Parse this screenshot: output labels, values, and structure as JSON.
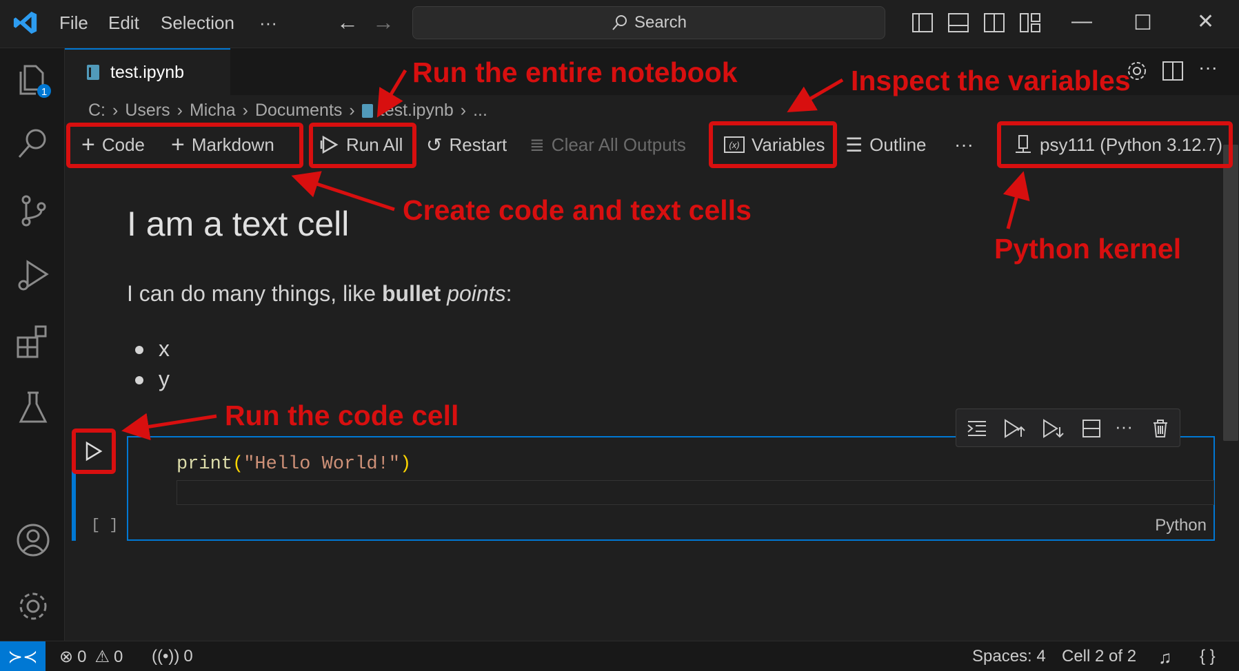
{
  "titlebar": {
    "menu": [
      "File",
      "Edit",
      "Selection",
      "···"
    ],
    "search_label": "Search"
  },
  "activity_bar": {
    "explorer_badge": "1"
  },
  "tab": {
    "label": "test.ipynb"
  },
  "breadcrumb": [
    "C:",
    "Users",
    "Micha",
    "Documents",
    "test.ipynb",
    "..."
  ],
  "notebook_toolbar": {
    "code": "Code",
    "markdown": "Markdown",
    "run_all": "Run All",
    "restart": "Restart",
    "clear_all_outputs": "Clear All Outputs",
    "variables": "Variables",
    "outline": "Outline",
    "more": "···",
    "kernel": "psy111 (Python 3.12.7)"
  },
  "markdown_cell": {
    "heading": "I am a text cell",
    "para_start": "I can do many things, like ",
    "para_bold": "bullet",
    "para_italic": "points",
    "para_end": ":",
    "bullets": [
      "x",
      "y"
    ]
  },
  "code_cell": {
    "code_fn": "print",
    "code_open": "(",
    "code_string": "\"Hello World!\"",
    "code_close": ")",
    "language": "Python",
    "exec_count": "[ ]"
  },
  "status_bar": {
    "errors": "0",
    "warnings": "0",
    "ports": "0",
    "spaces": "Spaces: 4",
    "cell_position": "Cell 2 of 2"
  },
  "annotations": {
    "run_entire": "Run the entire notebook",
    "inspect_vars": "Inspect the variables",
    "create_cells": "Create code and text cells",
    "python_kernel": "Python kernel",
    "run_code_cell": "Run the code cell"
  },
  "colors": {
    "accent": "#0078d4",
    "annotation": "#d80f0f",
    "code_fn": "#dcdcaa",
    "code_string": "#ce9178"
  }
}
